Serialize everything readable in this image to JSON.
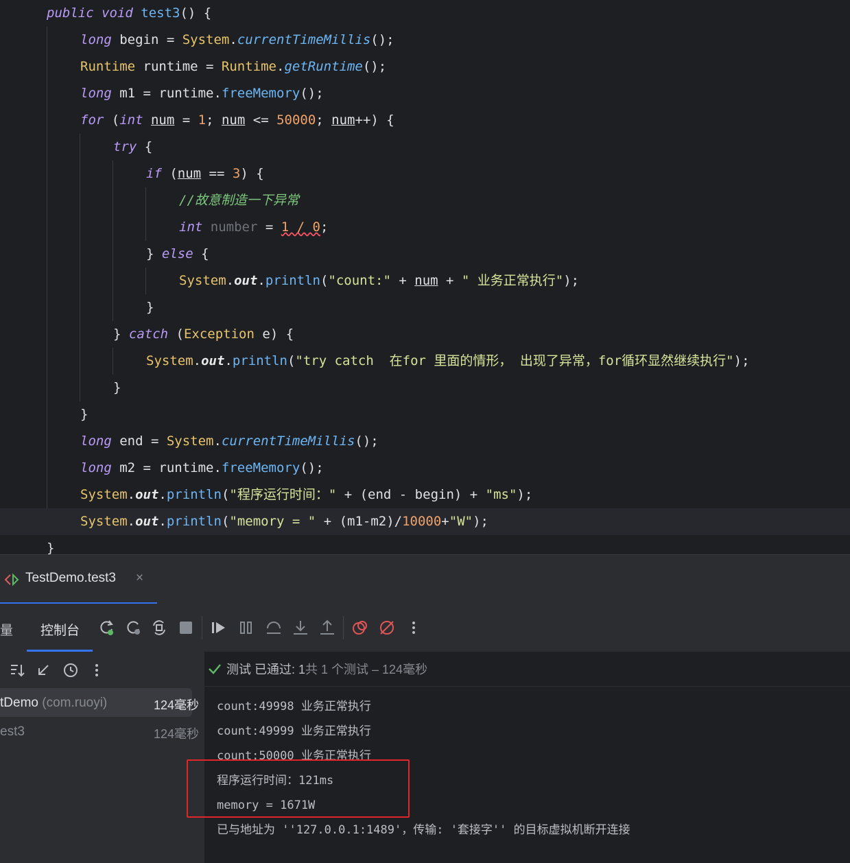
{
  "editor": {
    "lines": [
      {
        "id": "l1",
        "parts": [
          [
            "c-kw",
            "public "
          ],
          [
            "c-kw",
            "void "
          ],
          [
            "c-meth",
            "test3"
          ],
          [
            "c-var",
            "() {"
          ]
        ]
      },
      {
        "id": "l2",
        "parts": [
          [
            "c-kw",
            "long "
          ],
          [
            "c-var",
            "begin = "
          ],
          [
            "c-type",
            "System"
          ],
          [
            "c-var",
            "."
          ],
          [
            "c-smeth",
            "currentTimeMillis"
          ],
          [
            "c-var",
            "();"
          ]
        ]
      },
      {
        "id": "l3",
        "parts": [
          [
            "c-type",
            "Runtime "
          ],
          [
            "c-var",
            "runtime = "
          ],
          [
            "c-type",
            "Runtime"
          ],
          [
            "c-var",
            "."
          ],
          [
            "c-smeth",
            "getRuntime"
          ],
          [
            "c-var",
            "();"
          ]
        ]
      },
      {
        "id": "l4",
        "parts": [
          [
            "c-kw",
            "long "
          ],
          [
            "c-var",
            "m1 = runtime."
          ],
          [
            "c-meth",
            "freeMemory"
          ],
          [
            "c-var",
            "();"
          ]
        ]
      },
      {
        "id": "l5",
        "parts": [
          [
            "c-kw",
            "for "
          ],
          [
            "c-var",
            "("
          ],
          [
            "c-kw",
            "int "
          ],
          [
            "c-var ul",
            "num"
          ],
          [
            "c-var",
            " = "
          ],
          [
            "c-num",
            "1"
          ],
          [
            "c-var",
            "; "
          ],
          [
            "c-var ul",
            "num"
          ],
          [
            "c-var",
            " <= "
          ],
          [
            "c-num",
            "50000"
          ],
          [
            "c-var",
            "; "
          ],
          [
            "c-var ul",
            "num"
          ],
          [
            "c-var",
            "++) {"
          ]
        ]
      },
      {
        "id": "l6",
        "parts": [
          [
            "c-kw",
            "try "
          ],
          [
            "c-var",
            "{"
          ]
        ]
      },
      {
        "id": "l7",
        "parts": [
          [
            "c-kw",
            "if "
          ],
          [
            "c-var",
            "("
          ],
          [
            "c-var ul",
            "num"
          ],
          [
            "c-var",
            " == "
          ],
          [
            "c-num",
            "3"
          ],
          [
            "c-var",
            ") {"
          ]
        ]
      },
      {
        "id": "l8",
        "parts": [
          [
            "c-cmt",
            "//故意制造一下异常"
          ]
        ]
      },
      {
        "id": "l9",
        "parts": [
          [
            "c-kw",
            "int "
          ],
          [
            "c-dim",
            "number"
          ],
          [
            "c-var",
            " = "
          ],
          [
            "c-num err",
            "1 / 0"
          ],
          [
            "c-var",
            ";"
          ]
        ]
      },
      {
        "id": "l10",
        "parts": [
          [
            "c-var",
            "} "
          ],
          [
            "c-kw",
            "else "
          ],
          [
            "c-var",
            "{"
          ]
        ]
      },
      {
        "id": "l11",
        "parts": [
          [
            "c-type",
            "System"
          ],
          [
            "c-var",
            "."
          ],
          [
            "c-field",
            "out"
          ],
          [
            "c-var",
            "."
          ],
          [
            "c-meth",
            "println"
          ],
          [
            "c-var",
            "("
          ],
          [
            "c-str",
            "\"count:\""
          ],
          [
            "c-var",
            " + "
          ],
          [
            "c-var ul",
            "num"
          ],
          [
            "c-var",
            " + "
          ],
          [
            "c-str",
            "\" 业务正常执行\""
          ],
          [
            "c-var",
            ");"
          ]
        ]
      },
      {
        "id": "l12",
        "parts": [
          [
            "c-var",
            "}"
          ]
        ]
      },
      {
        "id": "l13",
        "parts": [
          [
            "c-var",
            "} "
          ],
          [
            "c-catch",
            "catch "
          ],
          [
            "c-var",
            "("
          ],
          [
            "c-type",
            "Exception "
          ],
          [
            "c-var",
            "e) {"
          ]
        ]
      },
      {
        "id": "l14",
        "parts": [
          [
            "c-type",
            "System"
          ],
          [
            "c-var",
            "."
          ],
          [
            "c-field",
            "out"
          ],
          [
            "c-var",
            "."
          ],
          [
            "c-meth",
            "println"
          ],
          [
            "c-var",
            "("
          ],
          [
            "c-str",
            "\"try catch  在for 里面的情形， 出现了异常，for循环显然继续执行\""
          ],
          [
            "c-var",
            ");"
          ]
        ]
      },
      {
        "id": "l15",
        "parts": [
          [
            "c-var",
            "}"
          ]
        ]
      },
      {
        "id": "l16",
        "parts": [
          [
            "c-var",
            "}"
          ]
        ]
      },
      {
        "id": "l17",
        "parts": [
          [
            "c-kw",
            "long "
          ],
          [
            "c-var",
            "end = "
          ],
          [
            "c-type",
            "System"
          ],
          [
            "c-var",
            "."
          ],
          [
            "c-smeth",
            "currentTimeMillis"
          ],
          [
            "c-var",
            "();"
          ]
        ]
      },
      {
        "id": "l18",
        "parts": [
          [
            "c-kw",
            "long "
          ],
          [
            "c-var",
            "m2 = runtime."
          ],
          [
            "c-meth",
            "freeMemory"
          ],
          [
            "c-var",
            "();"
          ]
        ]
      },
      {
        "id": "l19",
        "parts": [
          [
            "c-type",
            "System"
          ],
          [
            "c-var",
            "."
          ],
          [
            "c-field",
            "out"
          ],
          [
            "c-var",
            "."
          ],
          [
            "c-meth",
            "println"
          ],
          [
            "c-var",
            "("
          ],
          [
            "c-str",
            "\"程序运行时间：\""
          ],
          [
            "c-var",
            " + (end - begin) + "
          ],
          [
            "c-str",
            "\"ms\""
          ],
          [
            "c-var",
            ");"
          ]
        ]
      },
      {
        "id": "l20",
        "parts": [
          [
            "c-type",
            "System"
          ],
          [
            "c-var",
            "."
          ],
          [
            "c-field",
            "out"
          ],
          [
            "c-var",
            "."
          ],
          [
            "c-meth",
            "println"
          ],
          [
            "c-var",
            "("
          ],
          [
            "c-str",
            "\"memory = \""
          ],
          [
            "c-var",
            " + (m1-m2)/"
          ],
          [
            "c-num",
            "10000"
          ],
          [
            "c-var",
            "+"
          ],
          [
            "c-str",
            "\"W\""
          ],
          [
            "c-var",
            ");"
          ]
        ]
      },
      {
        "id": "l21",
        "parts": [
          [
            "c-var",
            "}"
          ]
        ]
      }
    ]
  },
  "run_tab": {
    "label": "TestDemo.test3",
    "close": "×"
  },
  "toolbar": {
    "variables_tab": "量",
    "console_tab": "控制台"
  },
  "status": {
    "check_icon": "check-icon",
    "passed": "测试 已通过: 1",
    "detail": "共 1 个测试 – 124毫秒"
  },
  "tree": [
    {
      "name": "tDemo",
      "pkg": " (com.ruoyi)",
      "time": "124毫秒"
    },
    {
      "name": "est3",
      "pkg": "",
      "time": "124毫秒"
    }
  ],
  "console": {
    "lines": [
      "count:49998 业务正常执行",
      "count:49999 业务正常执行",
      "count:50000 业务正常执行",
      "程序运行时间：121ms",
      "memory = 1671W",
      "已与地址为 ''127.0.0.1:1489'，传输: '套接字'' 的目标虚拟机断开连接"
    ]
  },
  "colors": {
    "accent": "#3574f0",
    "highlight_box": "#e0262b",
    "pass_green": "#5fb865"
  }
}
